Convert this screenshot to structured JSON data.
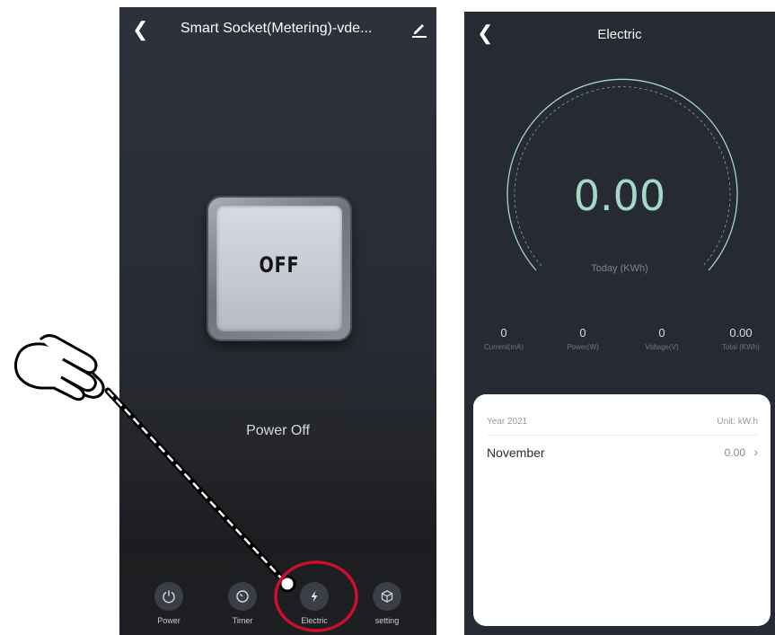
{
  "left_screen": {
    "title": "Smart Socket(Metering)-vde...",
    "switch_label": "OFF",
    "status": "Power Off",
    "tabs": [
      {
        "label": "Power",
        "icon": "power-icon"
      },
      {
        "label": "Timer",
        "icon": "timer-icon"
      },
      {
        "label": "Electric",
        "icon": "lightning-icon"
      },
      {
        "label": "setting",
        "icon": "cube-icon"
      }
    ]
  },
  "right_screen": {
    "title": "Electric",
    "gauge_value": "0.00",
    "gauge_label": "Today (KWh)",
    "stats": [
      {
        "value": "0",
        "label": "Current(mA)"
      },
      {
        "value": "0",
        "label": "Power(W)"
      },
      {
        "value": "0",
        "label": "Voltage(V)"
      },
      {
        "value": "0.00",
        "label": "Total (KWh)"
      }
    ],
    "card": {
      "year": "Year 2021",
      "unit": "Unit: kW.h",
      "rows": [
        {
          "month": "November",
          "value": "0.00"
        }
      ]
    }
  },
  "colors": {
    "accent_gauge": "#a6d8c6",
    "annotation_red": "#c8102e"
  }
}
